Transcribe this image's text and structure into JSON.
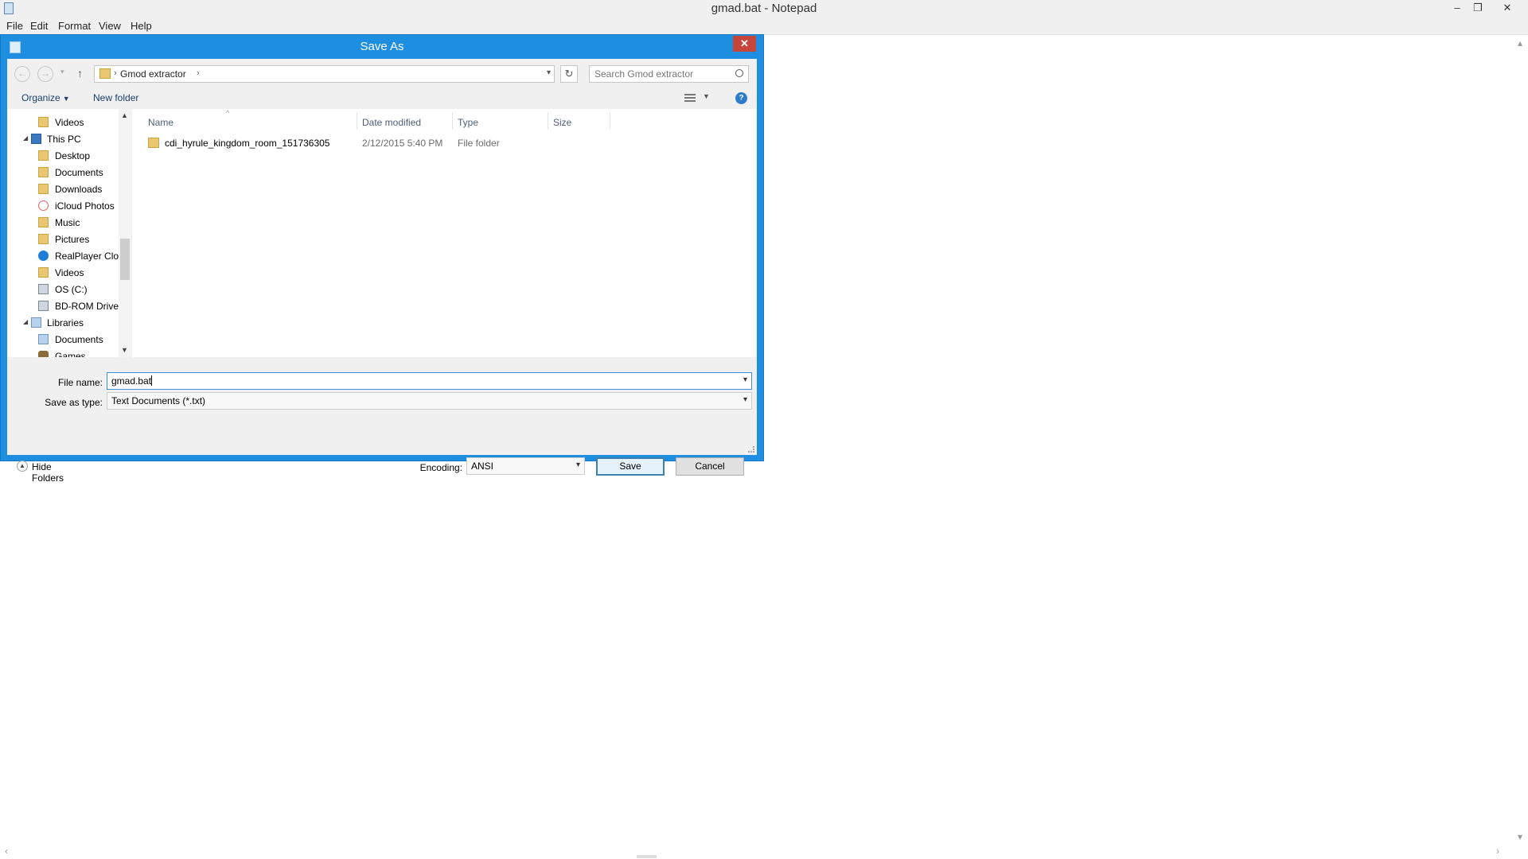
{
  "window": {
    "title": "gmad.bat - Notepad",
    "controls": {
      "minimize": "–",
      "maximize": "❐",
      "close": "✕"
    }
  },
  "menubar": [
    "File",
    "Edit",
    "Format",
    "View",
    "Help"
  ],
  "dialog": {
    "title": "Save As",
    "close_label": "✕",
    "address": {
      "crumb": "Gmod extractor",
      "separator": "›"
    },
    "search": {
      "placeholder": "Search Gmod extractor"
    },
    "toolbar": {
      "organize": "Organize",
      "new_folder": "New folder",
      "help": "?"
    },
    "nav_tree": [
      {
        "label": "Videos",
        "icon": "videos-icon",
        "level": 2
      },
      {
        "label": "This PC",
        "icon": "computer-icon",
        "level": 1
      },
      {
        "label": "Desktop",
        "icon": "folder-icon",
        "level": 2
      },
      {
        "label": "Documents",
        "icon": "folder-icon",
        "level": 2
      },
      {
        "label": "Downloads",
        "icon": "folder-icon",
        "level": 2
      },
      {
        "label": "iCloud Photos",
        "icon": "icloud-icon",
        "level": 2
      },
      {
        "label": "Music",
        "icon": "folder-icon",
        "level": 2
      },
      {
        "label": "Pictures",
        "icon": "folder-icon",
        "level": 2
      },
      {
        "label": "RealPlayer Clou",
        "icon": "realplayer-icon",
        "level": 2
      },
      {
        "label": "Videos",
        "icon": "folder-icon",
        "level": 2
      },
      {
        "label": "OS (C:)",
        "icon": "drive-icon",
        "level": 2
      },
      {
        "label": "BD-ROM Drive",
        "icon": "disc-drive-icon",
        "level": 2
      },
      {
        "label": "Libraries",
        "icon": "library-icon",
        "level": 1
      },
      {
        "label": "Documents",
        "icon": "library-icon",
        "level": 2
      },
      {
        "label": "Games",
        "icon": "games-icon",
        "level": 2
      }
    ],
    "columns": {
      "name": "Name",
      "date": "Date modified",
      "type": "Type",
      "size": "Size"
    },
    "files": [
      {
        "name": "cdi_hyrule_kingdom_room_151736305",
        "date": "2/12/2015 5:40 PM",
        "type": "File folder",
        "size": ""
      }
    ],
    "file_name_label": "File name:",
    "file_name_value": "gmad.bat",
    "save_type_label": "Save as type:",
    "save_type_value": "Text Documents (*.txt)",
    "hide_folders": "Hide Folders",
    "encoding_label": "Encoding:",
    "encoding_value": "ANSI",
    "save_button": "Save",
    "cancel_button": "Cancel"
  },
  "colors": {
    "dialog_frame": "#1e8fe0",
    "close_red": "#c7463c",
    "link_blue": "#1a3e6e"
  }
}
